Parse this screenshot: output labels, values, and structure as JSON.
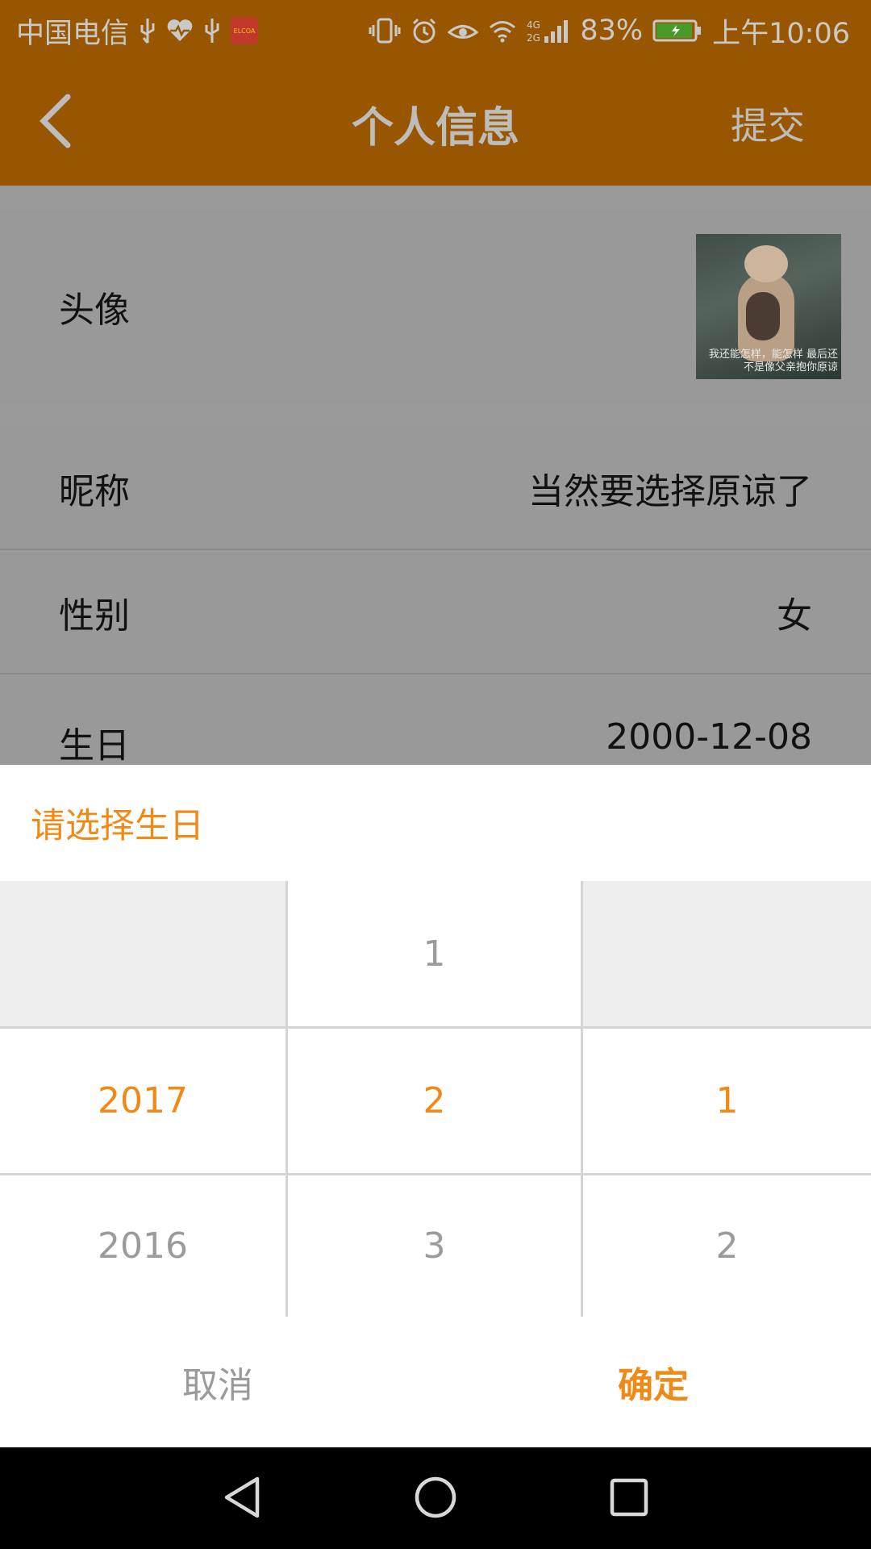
{
  "status_bar": {
    "carrier": "中国电信",
    "signal_label": "4G 2G",
    "battery_percent": "83%",
    "time": "上午10:06",
    "app_icon_text": "ELCOA"
  },
  "header": {
    "back_icon": "chevron-left-icon",
    "title": "个人信息",
    "submit_label": "提交"
  },
  "profile": {
    "avatar_label": "头像",
    "avatar_caption": "我还能怎样，能怎样 最后还不是像父亲抱你原谅",
    "nickname_label": "昵称",
    "nickname_value": "当然要选择原谅了",
    "gender_label": "性别",
    "gender_value": "女",
    "birthday_label": "生日",
    "birthday_value": "2000-12-08"
  },
  "picker": {
    "title": "请选择生日",
    "year": {
      "above": "",
      "selected": "2017",
      "below": "2016"
    },
    "month": {
      "above": "1",
      "selected": "2",
      "below": "3"
    },
    "day": {
      "above": "",
      "selected": "1",
      "below": "2"
    },
    "cancel_label": "取消",
    "confirm_label": "确定"
  },
  "colors": {
    "header_bg": "#985600",
    "accent": "#f08a16",
    "overlay_gray": "#999999"
  }
}
